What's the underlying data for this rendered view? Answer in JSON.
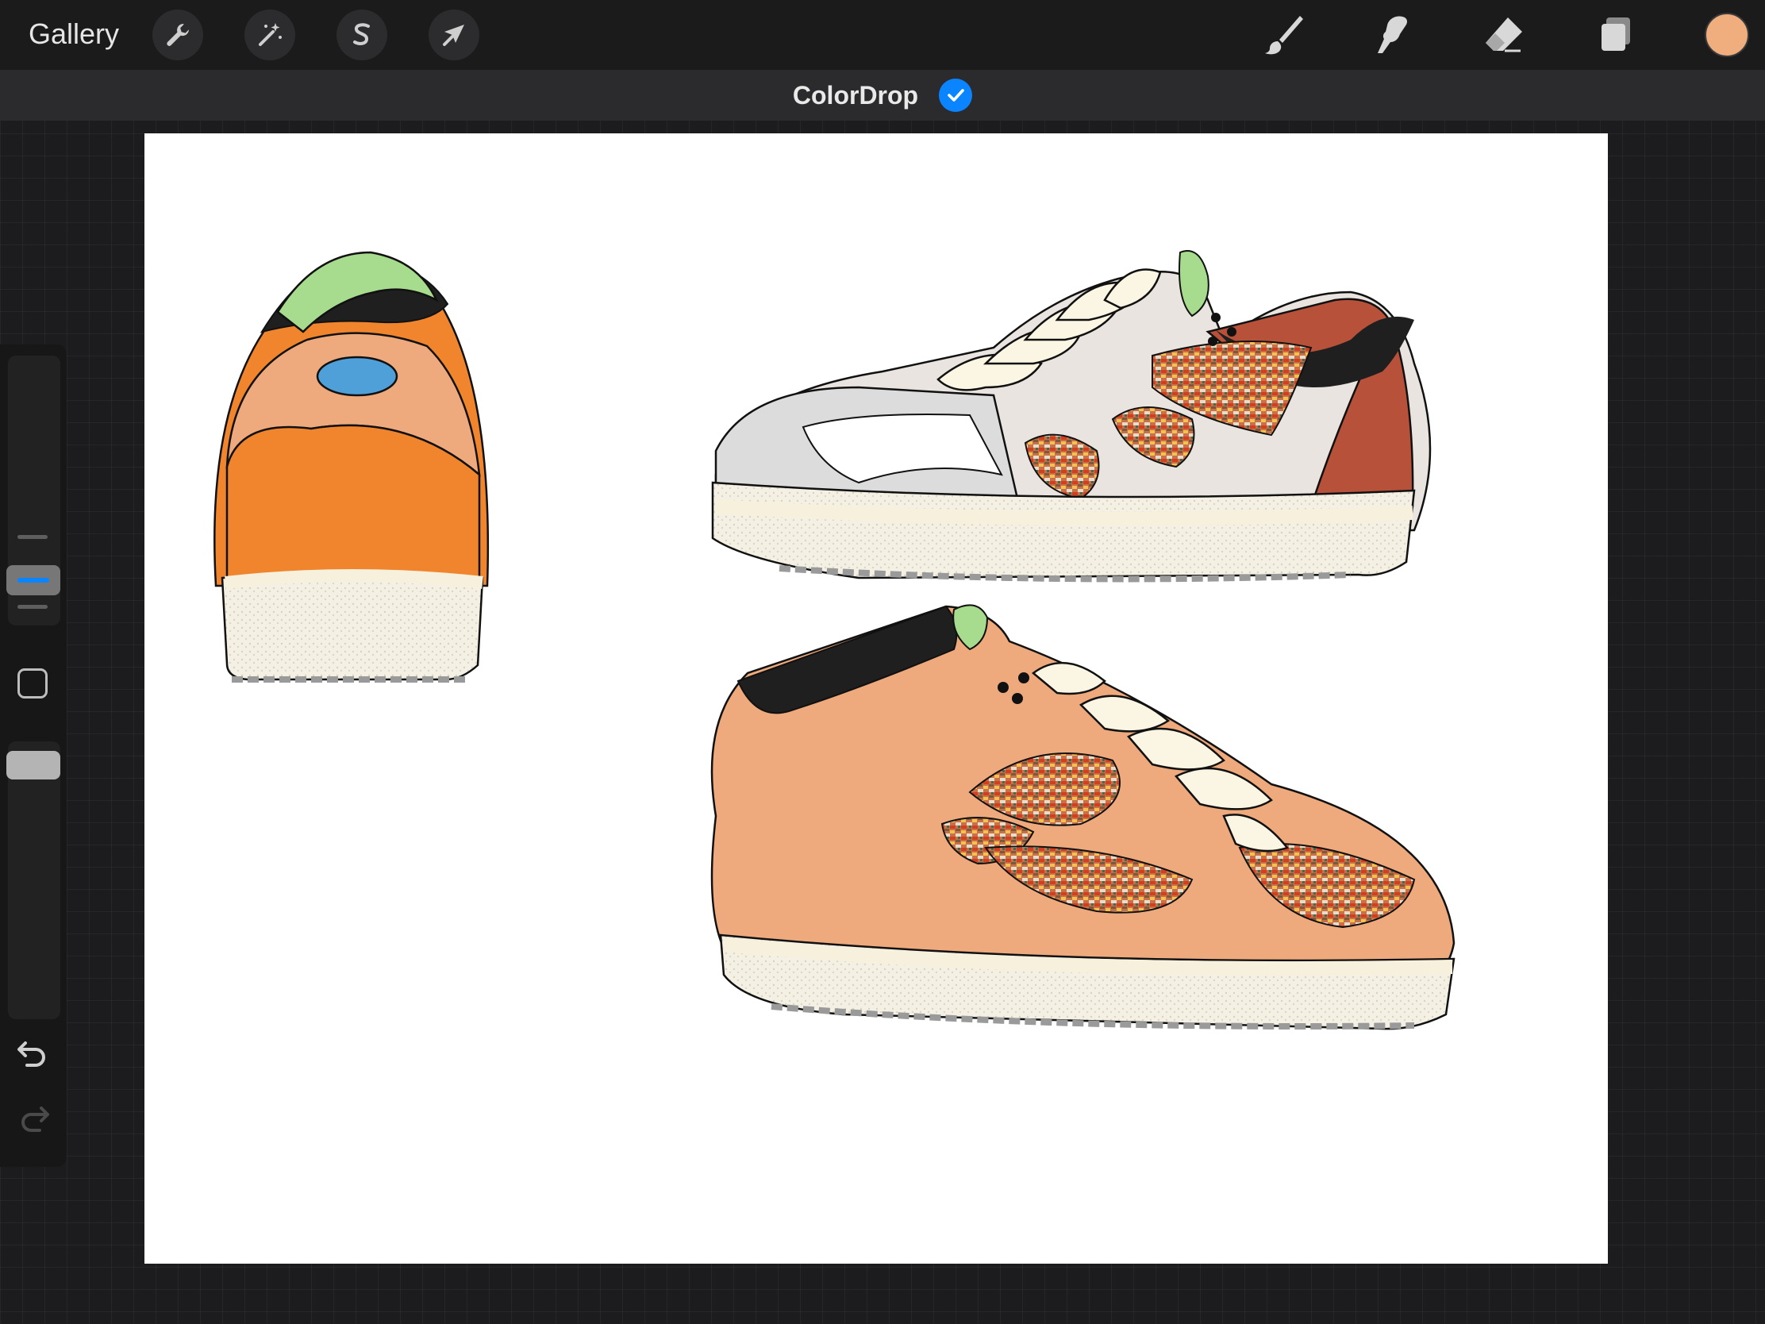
{
  "app": {
    "gallery_label": "Gallery",
    "document_title": "ColorDrop"
  },
  "toolbar_left": [
    {
      "name": "actions",
      "icon": "wrench-icon"
    },
    {
      "name": "adjustments",
      "icon": "magic-wand-icon"
    },
    {
      "name": "selection",
      "icon": "selection-s-icon"
    },
    {
      "name": "transform",
      "icon": "arrow-cursor-icon"
    }
  ],
  "toolbar_right": [
    {
      "name": "brush",
      "icon": "brush-icon"
    },
    {
      "name": "smudge",
      "icon": "smudge-finger-icon"
    },
    {
      "name": "eraser",
      "icon": "eraser-icon"
    },
    {
      "name": "layers",
      "icon": "layers-icon"
    }
  ],
  "colors": {
    "current_color": "#f0ad7e",
    "accent": "#0a84ff",
    "sneaker_orange": "#f0852e",
    "sneaker_peach": "#eea97c",
    "sneaker_rust": "#b8513a",
    "sneaker_grey": "#e9e4e0",
    "collar_green": "#a7db8d",
    "heel_blue": "#4f9fd8",
    "sole_cream": "#f6f0dd"
  },
  "sidebar": {
    "brush_size_icon": "brush-size-slider-icon",
    "modify_icon": "square-modify-icon",
    "opacity_icon": "opacity-slider-icon",
    "undo_icon": "undo-icon",
    "redo_icon": "redo-icon"
  }
}
